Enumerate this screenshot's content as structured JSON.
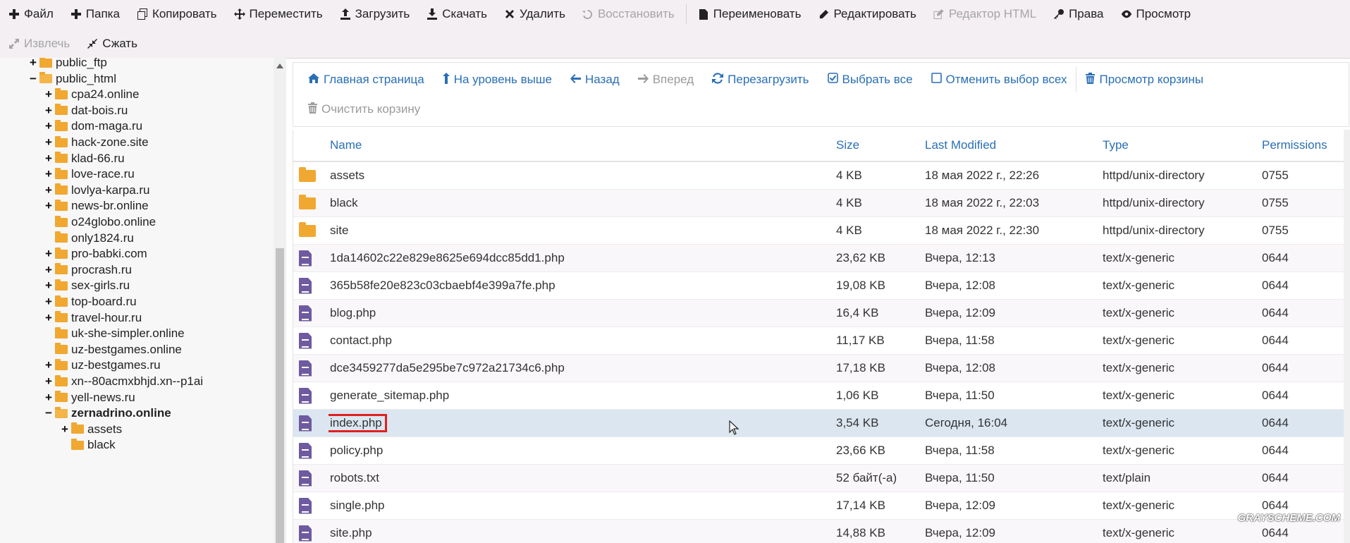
{
  "toolbar": {
    "row1": [
      {
        "label": "Файл",
        "icon": "plus-icon",
        "disabled": false
      },
      {
        "label": "Папка",
        "icon": "plus-icon",
        "disabled": false
      },
      {
        "label": "Копировать",
        "icon": "copy-icon",
        "disabled": false
      },
      {
        "label": "Переместить",
        "icon": "move-icon",
        "disabled": false
      },
      {
        "label": "Загрузить",
        "icon": "upload-icon",
        "disabled": false
      },
      {
        "label": "Скачать",
        "icon": "download-icon",
        "disabled": false
      },
      {
        "label": "Удалить",
        "icon": "close-icon",
        "disabled": false
      },
      {
        "label": "Восстановить",
        "icon": "restore-icon",
        "disabled": true
      },
      {
        "label": "Переименовать",
        "icon": "file-icon",
        "disabled": false
      },
      {
        "label": "Редактировать",
        "icon": "pencil-icon",
        "disabled": false
      },
      {
        "label": "Редактор HTML",
        "icon": "edit-icon",
        "disabled": true
      },
      {
        "label": "Права",
        "icon": "key-icon",
        "disabled": false
      },
      {
        "label": "Просмотр",
        "icon": "eye-icon",
        "disabled": false
      }
    ],
    "row2": [
      {
        "label": "Извлечь",
        "icon": "expand-icon",
        "disabled": true
      },
      {
        "label": "Сжать",
        "icon": "compress-icon",
        "disabled": false
      }
    ]
  },
  "tree": [
    {
      "label": "public_ftp",
      "toggle": "+",
      "level": 2,
      "bold": false,
      "open": false
    },
    {
      "label": "public_html",
      "toggle": "−",
      "level": 2,
      "bold": false,
      "open": true
    },
    {
      "label": "cpa24.online",
      "toggle": "+",
      "level": 3,
      "bold": false,
      "open": false
    },
    {
      "label": "dat-bois.ru",
      "toggle": "+",
      "level": 3,
      "bold": false,
      "open": false
    },
    {
      "label": "dom-maga.ru",
      "toggle": "+",
      "level": 3,
      "bold": false,
      "open": false
    },
    {
      "label": "hack-zone.site",
      "toggle": "+",
      "level": 3,
      "bold": false,
      "open": false
    },
    {
      "label": "klad-66.ru",
      "toggle": "+",
      "level": 3,
      "bold": false,
      "open": false
    },
    {
      "label": "love-race.ru",
      "toggle": "+",
      "level": 3,
      "bold": false,
      "open": false
    },
    {
      "label": "lovlya-karpa.ru",
      "toggle": "+",
      "level": 3,
      "bold": false,
      "open": false
    },
    {
      "label": "news-br.online",
      "toggle": "+",
      "level": 3,
      "bold": false,
      "open": false
    },
    {
      "label": "o24globo.online",
      "toggle": "",
      "level": 3,
      "bold": false,
      "open": false
    },
    {
      "label": "only1824.ru",
      "toggle": "",
      "level": 3,
      "bold": false,
      "open": false
    },
    {
      "label": "pro-babki.com",
      "toggle": "+",
      "level": 3,
      "bold": false,
      "open": false
    },
    {
      "label": "procrash.ru",
      "toggle": "+",
      "level": 3,
      "bold": false,
      "open": false
    },
    {
      "label": "sex-girls.ru",
      "toggle": "+",
      "level": 3,
      "bold": false,
      "open": false
    },
    {
      "label": "top-board.ru",
      "toggle": "+",
      "level": 3,
      "bold": false,
      "open": false
    },
    {
      "label": "travel-hour.ru",
      "toggle": "+",
      "level": 3,
      "bold": false,
      "open": false
    },
    {
      "label": "uk-she-simpler.online",
      "toggle": "",
      "level": 3,
      "bold": false,
      "open": false
    },
    {
      "label": "uz-bestgames.online",
      "toggle": "",
      "level": 3,
      "bold": false,
      "open": false
    },
    {
      "label": "uz-bestgames.ru",
      "toggle": "+",
      "level": 3,
      "bold": false,
      "open": false
    },
    {
      "label": "xn--80acmxbhjd.xn--p1ai",
      "toggle": "+",
      "level": 3,
      "bold": false,
      "open": false
    },
    {
      "label": "yell-news.ru",
      "toggle": "+",
      "level": 3,
      "bold": false,
      "open": false
    },
    {
      "label": "zernadrino.online",
      "toggle": "−",
      "level": 3,
      "bold": true,
      "open": true
    },
    {
      "label": "assets",
      "toggle": "+",
      "level": 4,
      "bold": false,
      "open": false
    },
    {
      "label": "black",
      "toggle": "",
      "level": 4,
      "bold": false,
      "open": false
    }
  ],
  "nav": {
    "row1": [
      {
        "label": "Главная страница",
        "icon": "home-icon",
        "disabled": false
      },
      {
        "label": "На уровень выше",
        "icon": "level-up-icon",
        "disabled": false
      },
      {
        "label": "Назад",
        "icon": "arrow-left-icon",
        "disabled": false
      },
      {
        "label": "Вперед",
        "icon": "arrow-right-icon",
        "disabled": true
      },
      {
        "label": "Перезагрузить",
        "icon": "refresh-icon",
        "disabled": false
      },
      {
        "label": "Выбрать все",
        "icon": "checkbox-checked-icon",
        "disabled": false
      },
      {
        "label": "Отменить выбор всех",
        "icon": "checkbox-empty-icon",
        "disabled": false
      },
      {
        "label": "Просмотр корзины",
        "icon": "trash-icon",
        "disabled": false
      }
    ],
    "row2": [
      {
        "label": "Очистить корзину",
        "icon": "trash-icon",
        "disabled": true
      }
    ]
  },
  "table": {
    "headers": {
      "name": "Name",
      "size": "Size",
      "modified": "Last Modified",
      "type": "Type",
      "permissions": "Permissions"
    },
    "rows": [
      {
        "kind": "folder",
        "name": "assets",
        "size": "4 KB",
        "modified": "18 мая 2022 г., 22:26",
        "type": "httpd/unix-directory",
        "perm": "0755",
        "selected": false
      },
      {
        "kind": "folder",
        "name": "black",
        "size": "4 KB",
        "modified": "18 мая 2022 г., 22:03",
        "type": "httpd/unix-directory",
        "perm": "0755",
        "selected": false
      },
      {
        "kind": "folder",
        "name": "site",
        "size": "4 KB",
        "modified": "18 мая 2022 г., 22:30",
        "type": "httpd/unix-directory",
        "perm": "0755",
        "selected": false
      },
      {
        "kind": "file",
        "name": "1da14602c22e829e8625e694dcc85dd1.php",
        "size": "23,62 KB",
        "modified": "Вчера, 12:13",
        "type": "text/x-generic",
        "perm": "0644",
        "selected": false
      },
      {
        "kind": "file",
        "name": "365b58fe20e823c03cbaebf4e399a7fe.php",
        "size": "19,08 KB",
        "modified": "Вчера, 12:08",
        "type": "text/x-generic",
        "perm": "0644",
        "selected": false
      },
      {
        "kind": "file",
        "name": "blog.php",
        "size": "16,4 KB",
        "modified": "Вчера, 12:09",
        "type": "text/x-generic",
        "perm": "0644",
        "selected": false
      },
      {
        "kind": "file",
        "name": "contact.php",
        "size": "11,17 KB",
        "modified": "Вчера, 11:58",
        "type": "text/x-generic",
        "perm": "0644",
        "selected": false
      },
      {
        "kind": "file",
        "name": "dce3459277da5e295be7c972a21734c6.php",
        "size": "17,18 KB",
        "modified": "Вчера, 12:08",
        "type": "text/x-generic",
        "perm": "0644",
        "selected": false
      },
      {
        "kind": "file",
        "name": "generate_sitemap.php",
        "size": "1,06 KB",
        "modified": "Вчера, 11:50",
        "type": "text/x-generic",
        "perm": "0644",
        "selected": false
      },
      {
        "kind": "file",
        "name": "index.php",
        "size": "3,54 KB",
        "modified": "Сегодня, 16:04",
        "type": "text/x-generic",
        "perm": "0644",
        "selected": true
      },
      {
        "kind": "file",
        "name": "policy.php",
        "size": "23,66 KB",
        "modified": "Вчера, 11:58",
        "type": "text/x-generic",
        "perm": "0644",
        "selected": false
      },
      {
        "kind": "file",
        "name": "robots.txt",
        "size": "52 байт(-а)",
        "modified": "Вчера, 11:50",
        "type": "text/plain",
        "perm": "0644",
        "selected": false
      },
      {
        "kind": "file",
        "name": "single.php",
        "size": "17,14 KB",
        "modified": "Вчера, 12:09",
        "type": "text/x-generic",
        "perm": "0644",
        "selected": false
      },
      {
        "kind": "file",
        "name": "site.php",
        "size": "14,88 KB",
        "modified": "Вчера, 12:09",
        "type": "text/x-generic",
        "perm": "0644",
        "selected": false
      }
    ]
  },
  "watermark": "GRAYSCHEME.COM",
  "colors": {
    "link": "#2a6fb5",
    "folder": "#f0a830",
    "file": "#6e5aa0",
    "selected_row": "#dbe6f1",
    "highlight": "#e02020"
  }
}
